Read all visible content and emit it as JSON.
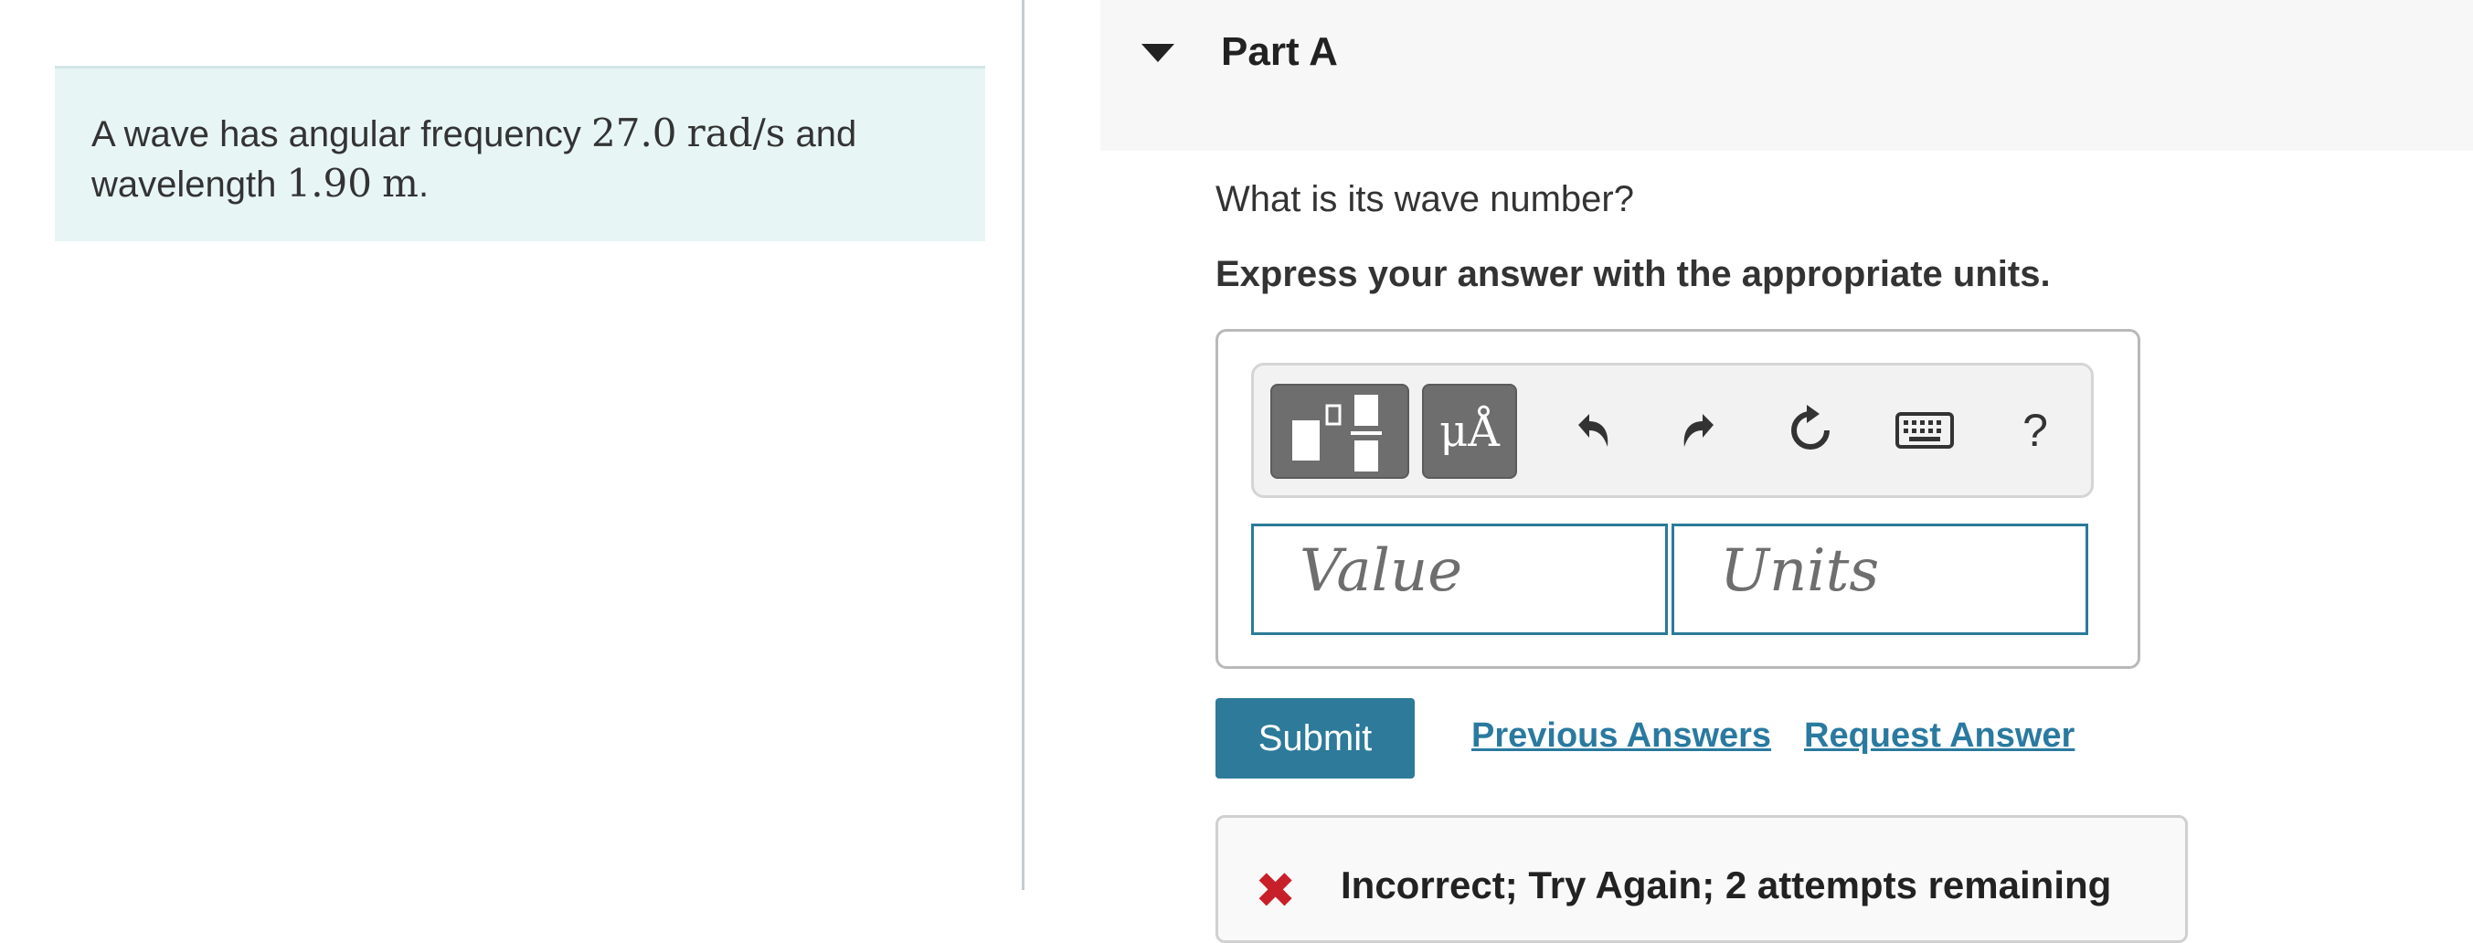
{
  "problem": {
    "text_before": "A wave has angular frequency ",
    "value1": "27.0",
    "unit1": "rad/s",
    "text_mid": " and",
    "text_line2": "wavelength ",
    "value2": "1.90",
    "unit2": "m",
    "text_end": "."
  },
  "part": {
    "title": "Part A",
    "question": "What is its wave number?",
    "instruction": "Express your answer with the appropriate units."
  },
  "toolbar": {
    "units_label": "μÅ",
    "undo_icon": "undo-icon",
    "redo_icon": "redo-icon",
    "reset_icon": "reset-icon",
    "keyboard_icon": "keyboard-icon",
    "help_label": "?"
  },
  "inputs": {
    "value_placeholder": "Value",
    "units_placeholder": "Units"
  },
  "actions": {
    "submit_label": "Submit",
    "previous_answers_label": "Previous Answers",
    "request_answer_label": "Request Answer"
  },
  "feedback": {
    "icon": "✖",
    "message": "Incorrect; Try Again; 2 attempts remaining"
  },
  "colors": {
    "accent": "#2d7a9a",
    "problem_bg": "#e8f5f5",
    "error": "#c8202a"
  }
}
